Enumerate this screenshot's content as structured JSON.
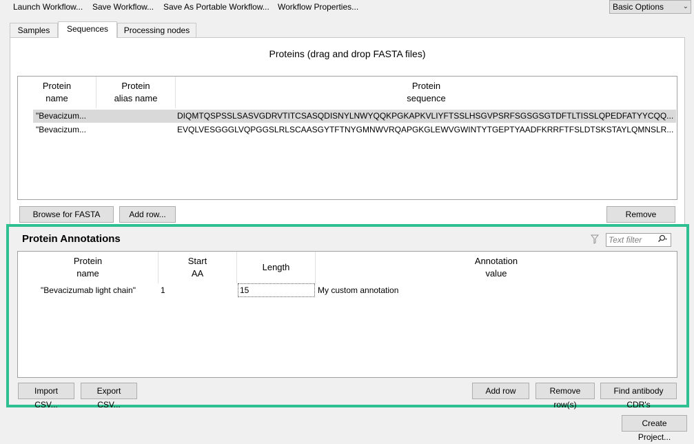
{
  "toolbar": {
    "launch": "Launch Workflow...",
    "save": "Save Workflow...",
    "save_portable": "Save As Portable Workflow...",
    "properties": "Workflow Properties...",
    "options_select": "Basic Options"
  },
  "tabs": [
    {
      "label": "Samples"
    },
    {
      "label": "Sequences"
    },
    {
      "label": "Processing nodes"
    }
  ],
  "proteins": {
    "title": "Proteins (drag and drop FASTA files)",
    "headers": {
      "name": [
        "Protein",
        "name"
      ],
      "alias": [
        "Protein",
        "alias name"
      ],
      "sequence": [
        "Protein",
        "sequence"
      ]
    },
    "rows": [
      {
        "name": "\"Bevacizum...",
        "alias": "",
        "sequence": "DIQMTQSPSSLSASVGDRVTITCSASQDISNYLNWYQQKPGKAPKVLIYFTSSLHSGVPSRFSGSGSGTDFTLTISSLQPEDFATYYCQQ..."
      },
      {
        "name": "\"Bevacizum...",
        "alias": "",
        "sequence": "EVQLVESGGGLVQPGGSLRLSCAASGYTFTNYGMNWVRQAPGKGLEWVGWINTYTGEPTYAADFKRRFTFSLDTSKSTAYLQMNSLR..."
      }
    ],
    "buttons": {
      "browse": "Browse for FASTA file...",
      "add_row": "Add row...",
      "remove_selected": "Remove selected"
    }
  },
  "annotations": {
    "title": "Protein Annotations",
    "filter_placeholder": "Text filter",
    "headers": {
      "name": [
        "Protein",
        "name"
      ],
      "start": [
        "Start",
        "AA"
      ],
      "length": [
        "Length"
      ],
      "value": [
        "Annotation",
        "value"
      ]
    },
    "rows": [
      {
        "name": "\"Bevacizumab light chain\"",
        "start": "1",
        "length": "15",
        "value": "My custom annotation"
      }
    ],
    "buttons": {
      "import": "Import CSV...",
      "export": "Export CSV...",
      "add_row": "Add row",
      "remove_rows": "Remove row(s)",
      "find_cdr": "Find antibody CDR's"
    }
  },
  "footer": {
    "create_project": "Create Project..."
  },
  "colors": {
    "highlight_border": "#2ec091",
    "selected_row": "#d9d9d9"
  }
}
